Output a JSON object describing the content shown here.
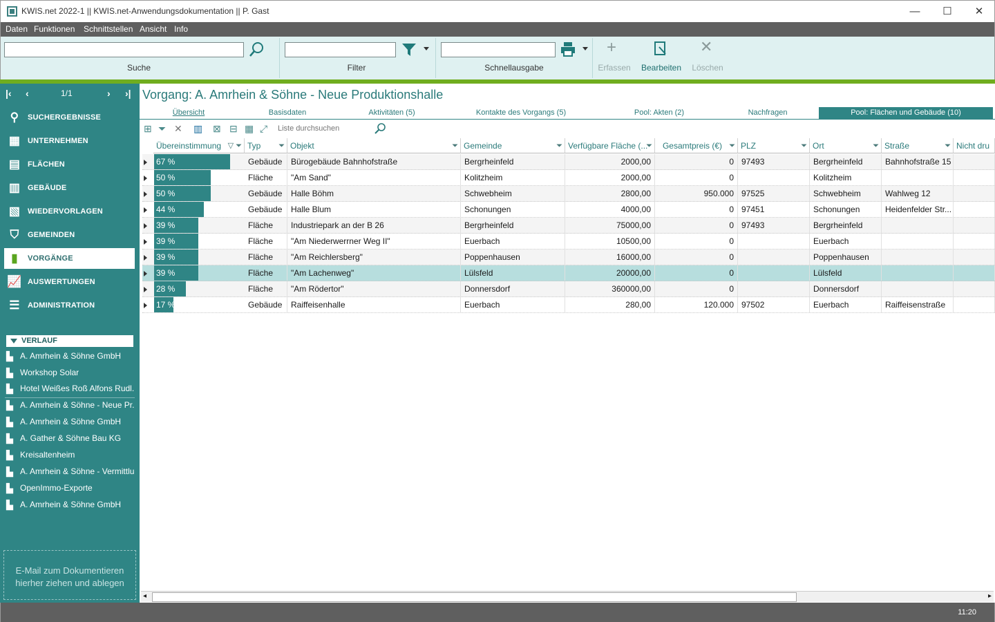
{
  "window": {
    "title": "KWIS.net 2022-1 || KWIS.net-Anwendungsdokumentation || P. Gast",
    "minimize": "—",
    "maximize": "☐",
    "close": "✕"
  },
  "menu": [
    "Daten",
    "Funktionen",
    "Schnittstellen",
    "Ansicht",
    "Info"
  ],
  "ribbon": {
    "search_label": "Suche",
    "search_value": "",
    "filter_label": "Filter",
    "filter_value": "",
    "quick_label": "Schnellausgabe",
    "quick_value": "",
    "add_label": "Erfassen",
    "edit_label": "Bearbeiten",
    "delete_label": "Löschen"
  },
  "sidebar": {
    "page": "1/1",
    "nav": {
      "first": "|‹",
      "prev": "‹",
      "next": "›",
      "last": "›|"
    },
    "items": [
      {
        "label": "SUCHERGEBNISSE",
        "icon": "search-icon",
        "glyph": "⚲"
      },
      {
        "label": "UNTERNEHMEN",
        "icon": "building-icon",
        "glyph": "▦"
      },
      {
        "label": "FLÄCHEN",
        "icon": "area-icon",
        "glyph": "▤"
      },
      {
        "label": "GEBÄUDE",
        "icon": "buildings-icon",
        "glyph": "▥"
      },
      {
        "label": "WIEDERVORLAGEN",
        "icon": "resubmission-icon",
        "glyph": "▧"
      },
      {
        "label": "GEMEINDEN",
        "icon": "municipality-shield-icon",
        "glyph": "⛉"
      },
      {
        "label": "VORGÄNGE",
        "icon": "process-icon",
        "glyph": "▮"
      },
      {
        "label": "AUSWERTUNGEN",
        "icon": "chart-icon",
        "glyph": "📈"
      },
      {
        "label": "ADMINISTRATION",
        "icon": "admin-icon",
        "glyph": "☰"
      }
    ],
    "verlauf_title": "VERLAUF",
    "verlauf": [
      "A. Amrhein & Söhne GmbH",
      "Workshop Solar",
      "Hotel Weißes Roß Alfons Rudl...",
      "A. Amrhein & Söhne - Neue Pr...",
      "A. Amrhein & Söhne GmbH",
      "A. Gather & Söhne Bau KG",
      "Kreisaltenheim",
      "A. Amrhein & Söhne - Vermittlu...",
      "OpenImmo-Exporte",
      "A. Amrhein & Söhne GmbH"
    ],
    "dropzone": "E-Mail  zum Dokumentieren hierher ziehen und ablegen"
  },
  "main": {
    "title": "Vorgang: A. Amrhein & Söhne - Neue Produktionshalle",
    "tabs": [
      "Übersicht",
      "Basisdaten",
      "Aktivitäten (5)",
      "Kontakte des Vorgangs (5)",
      "Pool: Akten (2)",
      "Nachfragen",
      "Pool: Flächen und Gebäude (10)"
    ],
    "list_search_placeholder": "Liste durchsuchen",
    "columns": [
      "Übereinstimmung",
      "Typ",
      "Objekt",
      "Gemeinde",
      "Verfügbare Fläche (...",
      "Gesamtpreis (€)",
      "PLZ",
      "Ort",
      "Straße",
      "Nicht dru"
    ],
    "rows": [
      {
        "match": "67 %",
        "match_value": 67,
        "typ": "Gebäude",
        "objekt": "Bürogebäude Bahnhofstraße",
        "gemeinde": "Bergrheinfeld",
        "flaeche": "2000,00",
        "preis": "0",
        "plz": "97493",
        "ort": "Bergrheinfeld",
        "strasse": "Bahnhofstraße 15"
      },
      {
        "match": "50 %",
        "match_value": 50,
        "typ": "Fläche",
        "objekt": "\"Am Sand\"",
        "gemeinde": "Kolitzheim",
        "flaeche": "2000,00",
        "preis": "0",
        "plz": "",
        "ort": "Kolitzheim",
        "strasse": ""
      },
      {
        "match": "50 %",
        "match_value": 50,
        "typ": "Gebäude",
        "objekt": "Halle Böhm",
        "gemeinde": "Schwebheim",
        "flaeche": "2800,00",
        "preis": "950.000",
        "plz": "97525",
        "ort": "Schwebheim",
        "strasse": "Wahlweg 12"
      },
      {
        "match": "44 %",
        "match_value": 44,
        "typ": "Gebäude",
        "objekt": "Halle Blum",
        "gemeinde": "Schonungen",
        "flaeche": "4000,00",
        "preis": "0",
        "plz": "97451",
        "ort": "Schonungen",
        "strasse": "Heidenfelder Str..."
      },
      {
        "match": "39 %",
        "match_value": 39,
        "typ": "Fläche",
        "objekt": "Industriepark an der B 26",
        "gemeinde": "Bergrheinfeld",
        "flaeche": "75000,00",
        "preis": "0",
        "plz": "97493",
        "ort": "Bergrheinfeld",
        "strasse": ""
      },
      {
        "match": "39 %",
        "match_value": 39,
        "typ": "Fläche",
        "objekt": "\"Am Niederwerrner Weg II\"",
        "gemeinde": "Euerbach",
        "flaeche": "10500,00",
        "preis": "0",
        "plz": "",
        "ort": "Euerbach",
        "strasse": ""
      },
      {
        "match": "39 %",
        "match_value": 39,
        "typ": "Fläche",
        "objekt": "\"Am Reichlersberg\"",
        "gemeinde": "Poppenhausen",
        "flaeche": "16000,00",
        "preis": "0",
        "plz": "",
        "ort": "Poppenhausen",
        "strasse": ""
      },
      {
        "match": "39 %",
        "match_value": 39,
        "typ": "Fläche",
        "objekt": "\"Am Lachenweg\"",
        "gemeinde": "Lülsfeld",
        "flaeche": "20000,00",
        "preis": "0",
        "plz": "",
        "ort": "Lülsfeld",
        "strasse": ""
      },
      {
        "match": "28 %",
        "match_value": 28,
        "typ": "Fläche",
        "objekt": "\"Am Rödertor\"",
        "gemeinde": "Donnersdorf",
        "flaeche": "360000,00",
        "preis": "0",
        "plz": "",
        "ort": "Donnersdorf",
        "strasse": ""
      },
      {
        "match": "17 %",
        "match_value": 17,
        "typ": "Gebäude",
        "objekt": "Raiffeisenhalle",
        "gemeinde": "Euerbach",
        "flaeche": "280,00",
        "preis": "120.000",
        "plz": "97502",
        "ort": "Euerbach",
        "strasse": "Raiffeisenstraße"
      }
    ],
    "selected_row": 7
  },
  "status": {
    "time": "11:20"
  },
  "colors": {
    "teal": "#2f8585",
    "green": "#70ad1f",
    "ribbon": "#dff1f1",
    "selected": "#b7dede"
  }
}
